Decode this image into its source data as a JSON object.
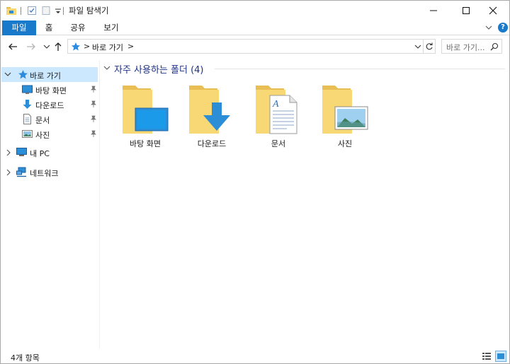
{
  "window": {
    "title": "파일 탐색기"
  },
  "ribbon": {
    "tabs": [
      "파일",
      "홈",
      "공유",
      "보기"
    ],
    "help_label": "?"
  },
  "address": {
    "breadcrumb": "바로 가기",
    "separator": ">"
  },
  "search": {
    "placeholder": "바로 가기..."
  },
  "nav": {
    "quick_access": "바로 가기",
    "pinned": [
      "바탕 화면",
      "다운로드",
      "문서",
      "사진"
    ],
    "this_pc": "내 PC",
    "network": "네트워크"
  },
  "content": {
    "group_title": "자주 사용하는 폴더 (4)",
    "folders": [
      "바탕 화면",
      "다운로드",
      "문서",
      "사진"
    ]
  },
  "status": {
    "item_count": "4개 항목"
  },
  "colors": {
    "accent": "#1979ca",
    "selection": "#cce8ff",
    "folder": "#f8d775",
    "group_title": "#1e3287"
  }
}
